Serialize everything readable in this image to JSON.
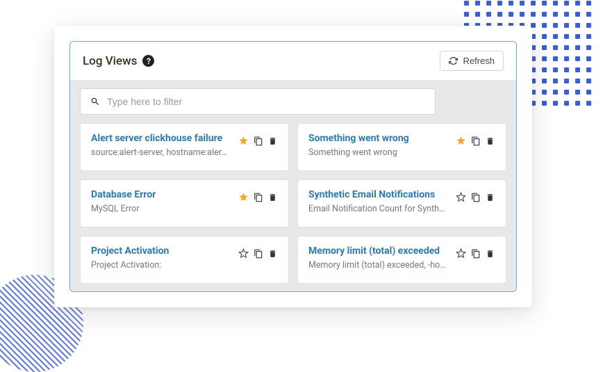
{
  "header": {
    "title": "Log Views",
    "refresh_label": "Refresh"
  },
  "filter": {
    "placeholder": "Type here to filter"
  },
  "cards": [
    {
      "title": "Alert server clickhouse failure",
      "desc": "source:alert-server, hostname:aler…",
      "starred": true
    },
    {
      "title": "Something went wrong",
      "desc": "Something went wrong",
      "starred": true
    },
    {
      "title": "Database Error",
      "desc": "MySQL Error",
      "starred": true
    },
    {
      "title": "Synthetic Email Notifications",
      "desc": "Email Notification Count for Synth…",
      "starred": false
    },
    {
      "title": "Project Activation",
      "desc": "Project Activation:",
      "starred": false
    },
    {
      "title": "Memory limit (total) exceeded",
      "desc": "Memory limit (total) exceeded, -ho…",
      "starred": false
    }
  ]
}
